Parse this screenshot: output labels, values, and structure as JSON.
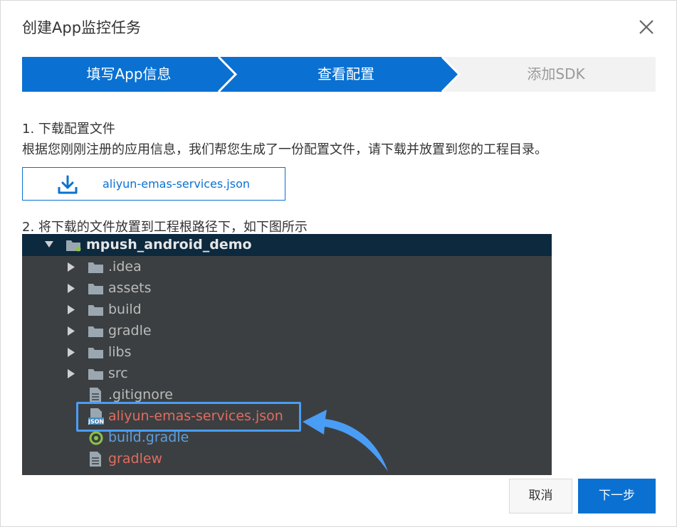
{
  "dialog": {
    "title": "创建App监控任务"
  },
  "steps": [
    {
      "label": "填写App信息",
      "state": "done"
    },
    {
      "label": "查看配置",
      "state": "active"
    },
    {
      "label": "添加SDK",
      "state": "pending"
    }
  ],
  "section1": {
    "heading": "1. 下载配置文件",
    "description": "根据您刚刚注册的应用信息，我们帮您生成了一份配置文件，请下载并放置到您的工程目录。",
    "download_label": "aliyun-emas-services.json"
  },
  "section2": {
    "heading": "2. 将下载的文件放置到工程根路径下，如下图所示"
  },
  "tree": {
    "root": "mpush_android_demo",
    "folders": [
      ".idea",
      "assets",
      "build",
      "gradle",
      "libs",
      "src"
    ],
    "files": [
      ".gitignore",
      "aliyun-emas-services.json",
      "build.gradle",
      "gradlew"
    ]
  },
  "footer": {
    "cancel_label": "取消",
    "next_label": "下一步"
  },
  "colors": {
    "primary": "#0a71d2",
    "ide_background": "#3c3f41",
    "ide_header": "#0d293e",
    "highlight": "#4a9df5",
    "red_file": "#d9534f",
    "gradle_file": "#5d9fe0"
  }
}
